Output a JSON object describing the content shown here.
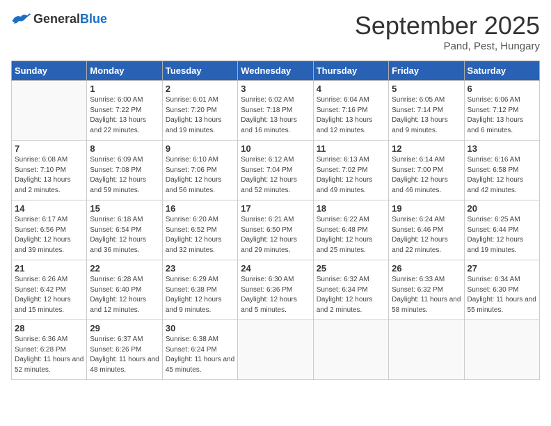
{
  "header": {
    "logo_general": "General",
    "logo_blue": "Blue",
    "month_title": "September 2025",
    "location": "Pand, Pest, Hungary"
  },
  "weekdays": [
    "Sunday",
    "Monday",
    "Tuesday",
    "Wednesday",
    "Thursday",
    "Friday",
    "Saturday"
  ],
  "weeks": [
    [
      {
        "day": null
      },
      {
        "day": "1",
        "sunrise": "6:00 AM",
        "sunset": "7:22 PM",
        "daylight": "13 hours and 22 minutes."
      },
      {
        "day": "2",
        "sunrise": "6:01 AM",
        "sunset": "7:20 PM",
        "daylight": "13 hours and 19 minutes."
      },
      {
        "day": "3",
        "sunrise": "6:02 AM",
        "sunset": "7:18 PM",
        "daylight": "13 hours and 16 minutes."
      },
      {
        "day": "4",
        "sunrise": "6:04 AM",
        "sunset": "7:16 PM",
        "daylight": "13 hours and 12 minutes."
      },
      {
        "day": "5",
        "sunrise": "6:05 AM",
        "sunset": "7:14 PM",
        "daylight": "13 hours and 9 minutes."
      },
      {
        "day": "6",
        "sunrise": "6:06 AM",
        "sunset": "7:12 PM",
        "daylight": "13 hours and 6 minutes."
      }
    ],
    [
      {
        "day": "7",
        "sunrise": "6:08 AM",
        "sunset": "7:10 PM",
        "daylight": "13 hours and 2 minutes."
      },
      {
        "day": "8",
        "sunrise": "6:09 AM",
        "sunset": "7:08 PM",
        "daylight": "12 hours and 59 minutes."
      },
      {
        "day": "9",
        "sunrise": "6:10 AM",
        "sunset": "7:06 PM",
        "daylight": "12 hours and 56 minutes."
      },
      {
        "day": "10",
        "sunrise": "6:12 AM",
        "sunset": "7:04 PM",
        "daylight": "12 hours and 52 minutes."
      },
      {
        "day": "11",
        "sunrise": "6:13 AM",
        "sunset": "7:02 PM",
        "daylight": "12 hours and 49 minutes."
      },
      {
        "day": "12",
        "sunrise": "6:14 AM",
        "sunset": "7:00 PM",
        "daylight": "12 hours and 46 minutes."
      },
      {
        "day": "13",
        "sunrise": "6:16 AM",
        "sunset": "6:58 PM",
        "daylight": "12 hours and 42 minutes."
      }
    ],
    [
      {
        "day": "14",
        "sunrise": "6:17 AM",
        "sunset": "6:56 PM",
        "daylight": "12 hours and 39 minutes."
      },
      {
        "day": "15",
        "sunrise": "6:18 AM",
        "sunset": "6:54 PM",
        "daylight": "12 hours and 36 minutes."
      },
      {
        "day": "16",
        "sunrise": "6:20 AM",
        "sunset": "6:52 PM",
        "daylight": "12 hours and 32 minutes."
      },
      {
        "day": "17",
        "sunrise": "6:21 AM",
        "sunset": "6:50 PM",
        "daylight": "12 hours and 29 minutes."
      },
      {
        "day": "18",
        "sunrise": "6:22 AM",
        "sunset": "6:48 PM",
        "daylight": "12 hours and 25 minutes."
      },
      {
        "day": "19",
        "sunrise": "6:24 AM",
        "sunset": "6:46 PM",
        "daylight": "12 hours and 22 minutes."
      },
      {
        "day": "20",
        "sunrise": "6:25 AM",
        "sunset": "6:44 PM",
        "daylight": "12 hours and 19 minutes."
      }
    ],
    [
      {
        "day": "21",
        "sunrise": "6:26 AM",
        "sunset": "6:42 PM",
        "daylight": "12 hours and 15 minutes."
      },
      {
        "day": "22",
        "sunrise": "6:28 AM",
        "sunset": "6:40 PM",
        "daylight": "12 hours and 12 minutes."
      },
      {
        "day": "23",
        "sunrise": "6:29 AM",
        "sunset": "6:38 PM",
        "daylight": "12 hours and 9 minutes."
      },
      {
        "day": "24",
        "sunrise": "6:30 AM",
        "sunset": "6:36 PM",
        "daylight": "12 hours and 5 minutes."
      },
      {
        "day": "25",
        "sunrise": "6:32 AM",
        "sunset": "6:34 PM",
        "daylight": "12 hours and 2 minutes."
      },
      {
        "day": "26",
        "sunrise": "6:33 AM",
        "sunset": "6:32 PM",
        "daylight": "11 hours and 58 minutes."
      },
      {
        "day": "27",
        "sunrise": "6:34 AM",
        "sunset": "6:30 PM",
        "daylight": "11 hours and 55 minutes."
      }
    ],
    [
      {
        "day": "28",
        "sunrise": "6:36 AM",
        "sunset": "6:28 PM",
        "daylight": "11 hours and 52 minutes."
      },
      {
        "day": "29",
        "sunrise": "6:37 AM",
        "sunset": "6:26 PM",
        "daylight": "11 hours and 48 minutes."
      },
      {
        "day": "30",
        "sunrise": "6:38 AM",
        "sunset": "6:24 PM",
        "daylight": "11 hours and 45 minutes."
      },
      {
        "day": null
      },
      {
        "day": null
      },
      {
        "day": null
      },
      {
        "day": null
      }
    ]
  ]
}
